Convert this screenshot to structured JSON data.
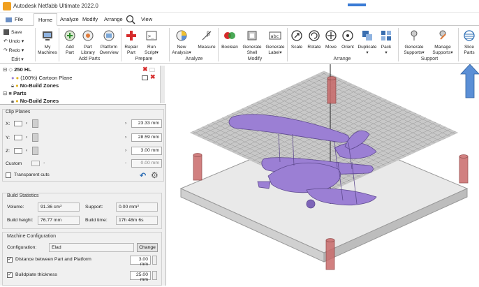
{
  "app": {
    "title": "Autodesk Netfabb Ultimate 2022.0"
  },
  "tabs": [
    {
      "label": "File"
    },
    {
      "label": "Home"
    },
    {
      "label": "Analyze"
    },
    {
      "label": "Modify"
    },
    {
      "label": "Arrange"
    },
    {
      "label": "View"
    }
  ],
  "ribbon": {
    "edit": {
      "save": "Save",
      "undo": "Undo",
      "redo": "Redo",
      "group": "Edit"
    },
    "add_parts": {
      "my_machines": [
        "My",
        "Machines"
      ],
      "add_part": [
        "Add",
        "Part"
      ],
      "part_library": [
        "Part",
        "Library"
      ],
      "platform_overview": [
        "Platform",
        "Overview"
      ],
      "group": "Add Parts"
    },
    "prepare": {
      "repair_part": [
        "Repair",
        "Part"
      ],
      "run_script": [
        "Run",
        "Script"
      ],
      "group": "Prepare"
    },
    "analyze": {
      "new_analysis": [
        "New",
        "Analysis"
      ],
      "measure": "Measure",
      "group": "Analyze"
    },
    "modify": {
      "boolean": "Boolean",
      "generate_shell": [
        "Generate",
        "Shell"
      ],
      "generate_label": [
        "Generate",
        "Label"
      ],
      "group": "Modify"
    },
    "arrange": {
      "scale": "Scale",
      "rotate": "Rotate",
      "move": "Move",
      "orient": "Orient",
      "duplicate": "Duplicate",
      "pack": "Pack",
      "group": "Arrange"
    },
    "support": {
      "generate_supports": [
        "Generate",
        "Supports"
      ],
      "manage_supports": [
        "Manage",
        "Supports"
      ],
      "group": "Support"
    },
    "slice": {
      "slice_parts": [
        "Slice",
        "Parts"
      ]
    }
  },
  "tree": {
    "machine": "250 HL",
    "cartoon_plane": "(100%) Cartoon Plane",
    "no_build_1": "No-Build Zones",
    "parts": "Parts",
    "no_build_2": "No-Build Zones"
  },
  "clip_planes": {
    "title": "Clip Planes",
    "x_label": "X:",
    "x_value": "23.33 mm",
    "y_label": "Y:",
    "y_value": "28.59 mm",
    "z_label": "Z:",
    "z_value": "3.00 mm",
    "custom_label": "Custom",
    "custom_value": "0.00 mm",
    "transparent_cuts": "Transparent cuts"
  },
  "build_stats": {
    "title": "Build Statistics",
    "volume_label": "Volume:",
    "volume_value": "91.36 cm³",
    "support_label": "Support:",
    "support_value": "0.00 mm³",
    "height_label": "Build height:",
    "height_value": "76.77 mm",
    "time_label": "Build time:",
    "time_value": "17h 48m 6s"
  },
  "machine_config": {
    "title": "Machine Configuration",
    "config_label": "Configuration:",
    "config_value": "Elad",
    "change": "Change",
    "distance_label": "Distance between Part and Platform",
    "distance_value": "3.00 mm",
    "buildplate_label": "Buildplate thickness",
    "buildplate_value": "25.00 mm"
  },
  "colors": {
    "accent": "#2f6fb5",
    "plane": "#9b7fd4",
    "pillar": "#c96a6a",
    "arrow": "#5b8fd6"
  }
}
